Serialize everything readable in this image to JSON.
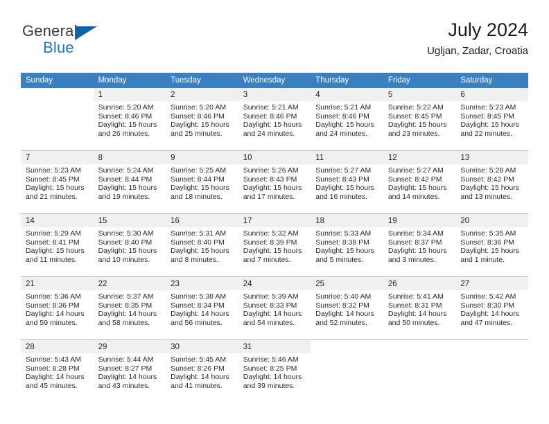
{
  "brand": {
    "name_part1": "General",
    "name_part2": "Blue",
    "logo_icon": "triangle-flag-icon"
  },
  "header": {
    "title": "July 2024",
    "subtitle": "Ugljan, Zadar, Croatia"
  },
  "calendar": {
    "accent_color": "#3a7fc1",
    "daynum_background": "#f0f0f0",
    "weekday_headers": [
      "Sunday",
      "Monday",
      "Tuesday",
      "Wednesday",
      "Thursday",
      "Friday",
      "Saturday"
    ],
    "weeks": [
      [
        {
          "day": "",
          "sunrise": "",
          "sunset": "",
          "daylight_line1": "",
          "daylight_line2": ""
        },
        {
          "day": "1",
          "sunrise": "Sunrise: 5:20 AM",
          "sunset": "Sunset: 8:46 PM",
          "daylight_line1": "Daylight: 15 hours",
          "daylight_line2": "and 26 minutes."
        },
        {
          "day": "2",
          "sunrise": "Sunrise: 5:20 AM",
          "sunset": "Sunset: 8:46 PM",
          "daylight_line1": "Daylight: 15 hours",
          "daylight_line2": "and 25 minutes."
        },
        {
          "day": "3",
          "sunrise": "Sunrise: 5:21 AM",
          "sunset": "Sunset: 8:46 PM",
          "daylight_line1": "Daylight: 15 hours",
          "daylight_line2": "and 24 minutes."
        },
        {
          "day": "4",
          "sunrise": "Sunrise: 5:21 AM",
          "sunset": "Sunset: 8:46 PM",
          "daylight_line1": "Daylight: 15 hours",
          "daylight_line2": "and 24 minutes."
        },
        {
          "day": "5",
          "sunrise": "Sunrise: 5:22 AM",
          "sunset": "Sunset: 8:45 PM",
          "daylight_line1": "Daylight: 15 hours",
          "daylight_line2": "and 23 minutes."
        },
        {
          "day": "6",
          "sunrise": "Sunrise: 5:23 AM",
          "sunset": "Sunset: 8:45 PM",
          "daylight_line1": "Daylight: 15 hours",
          "daylight_line2": "and 22 minutes."
        }
      ],
      [
        {
          "day": "7",
          "sunrise": "Sunrise: 5:23 AM",
          "sunset": "Sunset: 8:45 PM",
          "daylight_line1": "Daylight: 15 hours",
          "daylight_line2": "and 21 minutes."
        },
        {
          "day": "8",
          "sunrise": "Sunrise: 5:24 AM",
          "sunset": "Sunset: 8:44 PM",
          "daylight_line1": "Daylight: 15 hours",
          "daylight_line2": "and 19 minutes."
        },
        {
          "day": "9",
          "sunrise": "Sunrise: 5:25 AM",
          "sunset": "Sunset: 8:44 PM",
          "daylight_line1": "Daylight: 15 hours",
          "daylight_line2": "and 18 minutes."
        },
        {
          "day": "10",
          "sunrise": "Sunrise: 5:26 AM",
          "sunset": "Sunset: 8:43 PM",
          "daylight_line1": "Daylight: 15 hours",
          "daylight_line2": "and 17 minutes."
        },
        {
          "day": "11",
          "sunrise": "Sunrise: 5:27 AM",
          "sunset": "Sunset: 8:43 PM",
          "daylight_line1": "Daylight: 15 hours",
          "daylight_line2": "and 16 minutes."
        },
        {
          "day": "12",
          "sunrise": "Sunrise: 5:27 AM",
          "sunset": "Sunset: 8:42 PM",
          "daylight_line1": "Daylight: 15 hours",
          "daylight_line2": "and 14 minutes."
        },
        {
          "day": "13",
          "sunrise": "Sunrise: 5:28 AM",
          "sunset": "Sunset: 8:42 PM",
          "daylight_line1": "Daylight: 15 hours",
          "daylight_line2": "and 13 minutes."
        }
      ],
      [
        {
          "day": "14",
          "sunrise": "Sunrise: 5:29 AM",
          "sunset": "Sunset: 8:41 PM",
          "daylight_line1": "Daylight: 15 hours",
          "daylight_line2": "and 11 minutes."
        },
        {
          "day": "15",
          "sunrise": "Sunrise: 5:30 AM",
          "sunset": "Sunset: 8:40 PM",
          "daylight_line1": "Daylight: 15 hours",
          "daylight_line2": "and 10 minutes."
        },
        {
          "day": "16",
          "sunrise": "Sunrise: 5:31 AM",
          "sunset": "Sunset: 8:40 PM",
          "daylight_line1": "Daylight: 15 hours",
          "daylight_line2": "and 8 minutes."
        },
        {
          "day": "17",
          "sunrise": "Sunrise: 5:32 AM",
          "sunset": "Sunset: 8:39 PM",
          "daylight_line1": "Daylight: 15 hours",
          "daylight_line2": "and 7 minutes."
        },
        {
          "day": "18",
          "sunrise": "Sunrise: 5:33 AM",
          "sunset": "Sunset: 8:38 PM",
          "daylight_line1": "Daylight: 15 hours",
          "daylight_line2": "and 5 minutes."
        },
        {
          "day": "19",
          "sunrise": "Sunrise: 5:34 AM",
          "sunset": "Sunset: 8:37 PM",
          "daylight_line1": "Daylight: 15 hours",
          "daylight_line2": "and 3 minutes."
        },
        {
          "day": "20",
          "sunrise": "Sunrise: 5:35 AM",
          "sunset": "Sunset: 8:36 PM",
          "daylight_line1": "Daylight: 15 hours",
          "daylight_line2": "and 1 minute."
        }
      ],
      [
        {
          "day": "21",
          "sunrise": "Sunrise: 5:36 AM",
          "sunset": "Sunset: 8:36 PM",
          "daylight_line1": "Daylight: 14 hours",
          "daylight_line2": "and 59 minutes."
        },
        {
          "day": "22",
          "sunrise": "Sunrise: 5:37 AM",
          "sunset": "Sunset: 8:35 PM",
          "daylight_line1": "Daylight: 14 hours",
          "daylight_line2": "and 58 minutes."
        },
        {
          "day": "23",
          "sunrise": "Sunrise: 5:38 AM",
          "sunset": "Sunset: 8:34 PM",
          "daylight_line1": "Daylight: 14 hours",
          "daylight_line2": "and 56 minutes."
        },
        {
          "day": "24",
          "sunrise": "Sunrise: 5:39 AM",
          "sunset": "Sunset: 8:33 PM",
          "daylight_line1": "Daylight: 14 hours",
          "daylight_line2": "and 54 minutes."
        },
        {
          "day": "25",
          "sunrise": "Sunrise: 5:40 AM",
          "sunset": "Sunset: 8:32 PM",
          "daylight_line1": "Daylight: 14 hours",
          "daylight_line2": "and 52 minutes."
        },
        {
          "day": "26",
          "sunrise": "Sunrise: 5:41 AM",
          "sunset": "Sunset: 8:31 PM",
          "daylight_line1": "Daylight: 14 hours",
          "daylight_line2": "and 50 minutes."
        },
        {
          "day": "27",
          "sunrise": "Sunrise: 5:42 AM",
          "sunset": "Sunset: 8:30 PM",
          "daylight_line1": "Daylight: 14 hours",
          "daylight_line2": "and 47 minutes."
        }
      ],
      [
        {
          "day": "28",
          "sunrise": "Sunrise: 5:43 AM",
          "sunset": "Sunset: 8:28 PM",
          "daylight_line1": "Daylight: 14 hours",
          "daylight_line2": "and 45 minutes."
        },
        {
          "day": "29",
          "sunrise": "Sunrise: 5:44 AM",
          "sunset": "Sunset: 8:27 PM",
          "daylight_line1": "Daylight: 14 hours",
          "daylight_line2": "and 43 minutes."
        },
        {
          "day": "30",
          "sunrise": "Sunrise: 5:45 AM",
          "sunset": "Sunset: 8:26 PM",
          "daylight_line1": "Daylight: 14 hours",
          "daylight_line2": "and 41 minutes."
        },
        {
          "day": "31",
          "sunrise": "Sunrise: 5:46 AM",
          "sunset": "Sunset: 8:25 PM",
          "daylight_line1": "Daylight: 14 hours",
          "daylight_line2": "and 39 minutes."
        },
        {
          "day": "",
          "sunrise": "",
          "sunset": "",
          "daylight_line1": "",
          "daylight_line2": ""
        },
        {
          "day": "",
          "sunrise": "",
          "sunset": "",
          "daylight_line1": "",
          "daylight_line2": ""
        },
        {
          "day": "",
          "sunrise": "",
          "sunset": "",
          "daylight_line1": "",
          "daylight_line2": ""
        }
      ]
    ]
  }
}
